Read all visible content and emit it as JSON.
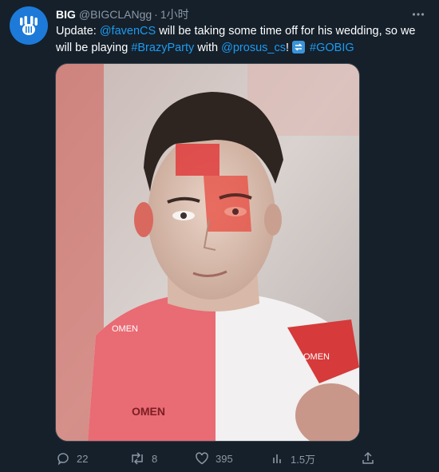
{
  "tweet": {
    "author_name": "BIG",
    "author_handle": "@BIGCLANgg",
    "separator": "·",
    "time": "1小时",
    "text_parts": {
      "p1": "Update: ",
      "mention_faven": "@favenCS",
      "p2": " will be taking some time off for his wedding, so we will be playing ",
      "hashtag_brazyparty": "#BrazyParty",
      "p3": " with ",
      "mention_prosus": "@prosus_cs",
      "p4": "! ",
      "hashtag_gobig": "#GOBIG"
    }
  },
  "actions": {
    "reply_count": "22",
    "retweet_count": "8",
    "like_count": "395",
    "views_count": "1.5万"
  },
  "icons": {
    "more": "more-icon",
    "reply": "reply-icon",
    "retweet": "retweet-icon",
    "like": "like-icon",
    "views": "views-icon",
    "share": "share-icon"
  },
  "colors": {
    "background": "#15202b",
    "link": "#1d9bf0",
    "muted": "#8b98a5",
    "avatar_bg": "#1d7ad9"
  }
}
